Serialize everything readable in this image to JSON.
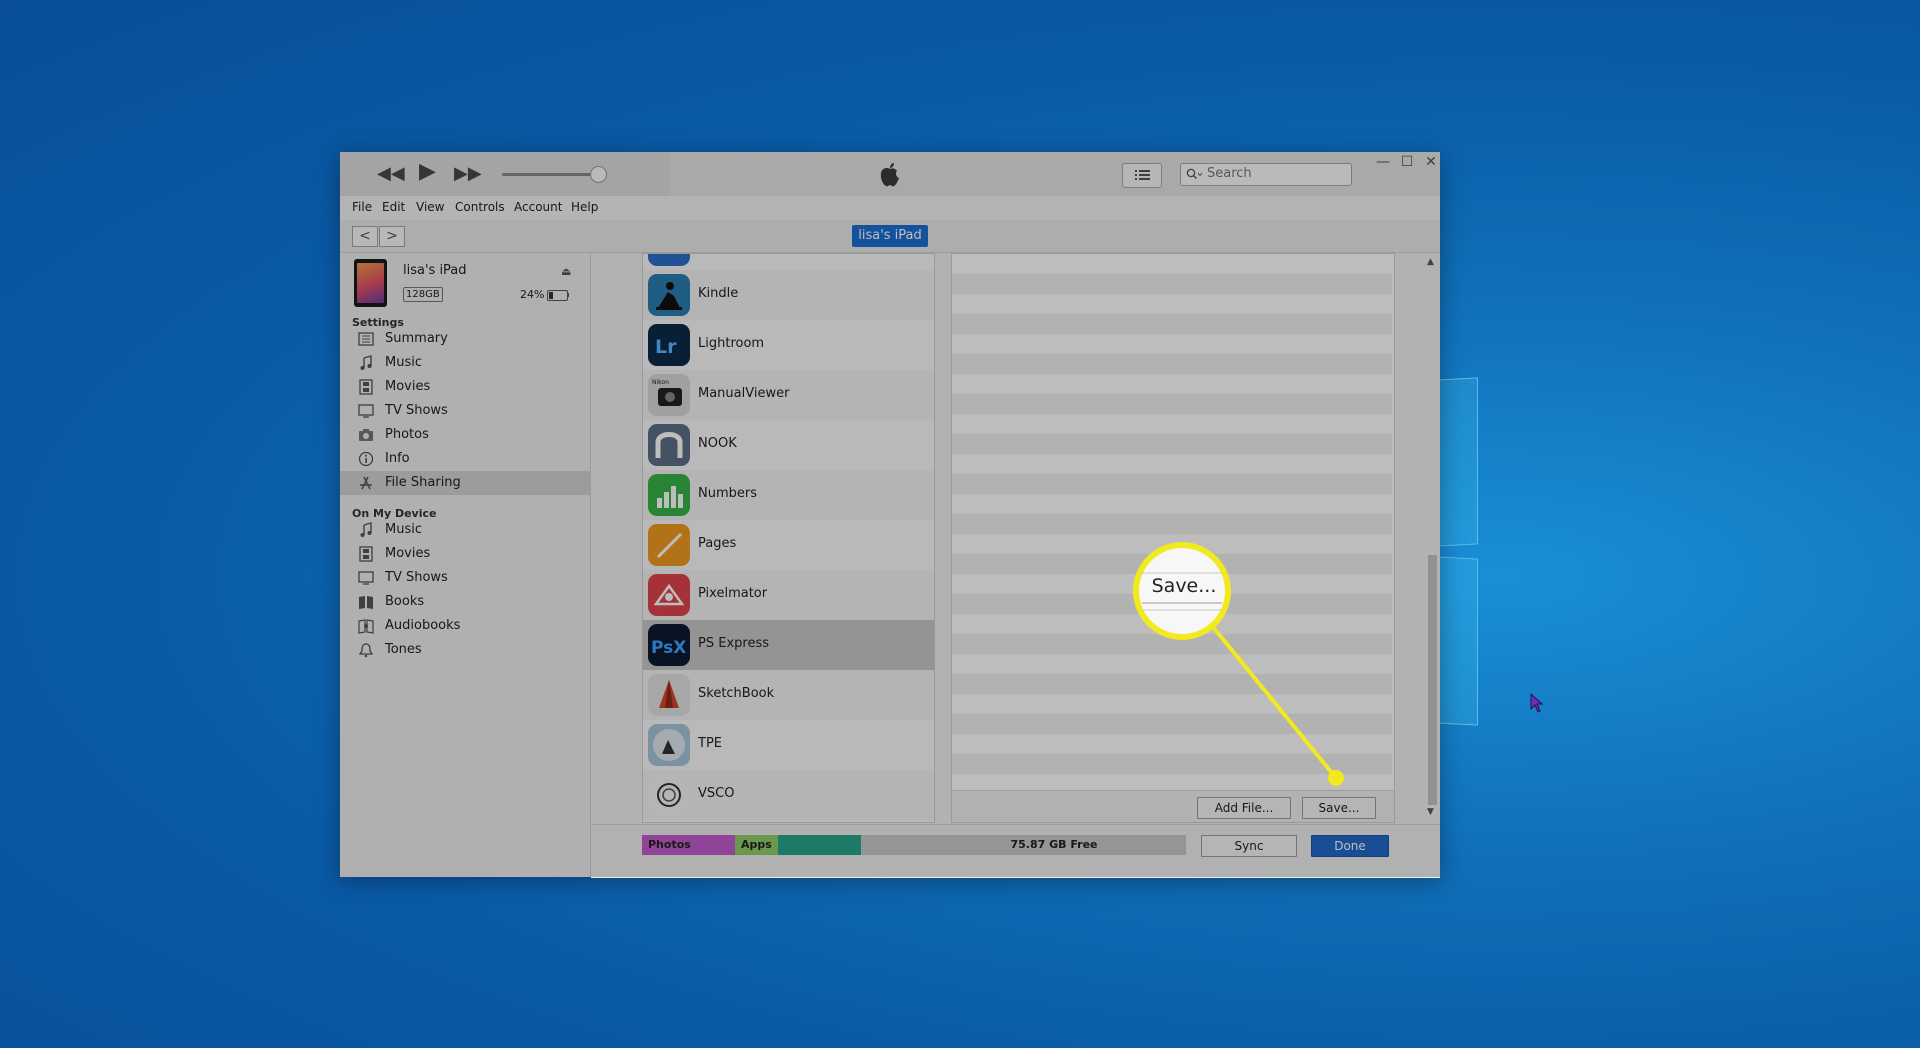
{
  "window": {
    "search_placeholder": "Search",
    "menus": [
      "File",
      "Edit",
      "View",
      "Controls",
      "Account",
      "Help"
    ],
    "device_pill": "lisa's iPad",
    "nav_back": "<",
    "nav_forward": ">"
  },
  "device": {
    "name": "lisa's iPad",
    "capacity": "128GB",
    "battery": "24%",
    "battery_level": 0.24
  },
  "sidebar": {
    "settings_header": "Settings",
    "settings_items": [
      {
        "label": "Summary",
        "icon": "summary-icon"
      },
      {
        "label": "Music",
        "icon": "music-note-icon"
      },
      {
        "label": "Movies",
        "icon": "film-icon"
      },
      {
        "label": "TV Shows",
        "icon": "tv-icon"
      },
      {
        "label": "Photos",
        "icon": "camera-icon"
      },
      {
        "label": "Info",
        "icon": "info-icon"
      },
      {
        "label": "File Sharing",
        "icon": "app-store-icon",
        "active": true
      }
    ],
    "device_header": "On My Device",
    "device_items": [
      {
        "label": "Music",
        "icon": "music-note-icon"
      },
      {
        "label": "Movies",
        "icon": "film-icon"
      },
      {
        "label": "TV Shows",
        "icon": "tv-icon"
      },
      {
        "label": "Books",
        "icon": "book-icon"
      },
      {
        "label": "Audiobooks",
        "icon": "audiobook-icon"
      },
      {
        "label": "Tones",
        "icon": "bell-icon"
      }
    ]
  },
  "apps": [
    {
      "label": "Kindle"
    },
    {
      "label": "Lightroom"
    },
    {
      "label": "ManualViewer"
    },
    {
      "label": "NOOK"
    },
    {
      "label": "Numbers"
    },
    {
      "label": "Pages"
    },
    {
      "label": "Pixelmator"
    },
    {
      "label": "PS Express",
      "selected": true
    },
    {
      "label": "SketchBook"
    },
    {
      "label": "TPE"
    },
    {
      "label": "VSCO"
    }
  ],
  "documents": {
    "add_file_label": "Add File...",
    "save_label": "Save..."
  },
  "storage": {
    "photos_label": "Photos",
    "apps_label": "Apps",
    "free_label": "75.87 GB Free",
    "colors": {
      "photos": "#c35ccc",
      "apps": "#8fcf6a",
      "other": "#27a58c"
    }
  },
  "footer": {
    "sync_label": "Sync",
    "done_label": "Done"
  },
  "callout": {
    "zoom_label": "Save..."
  }
}
